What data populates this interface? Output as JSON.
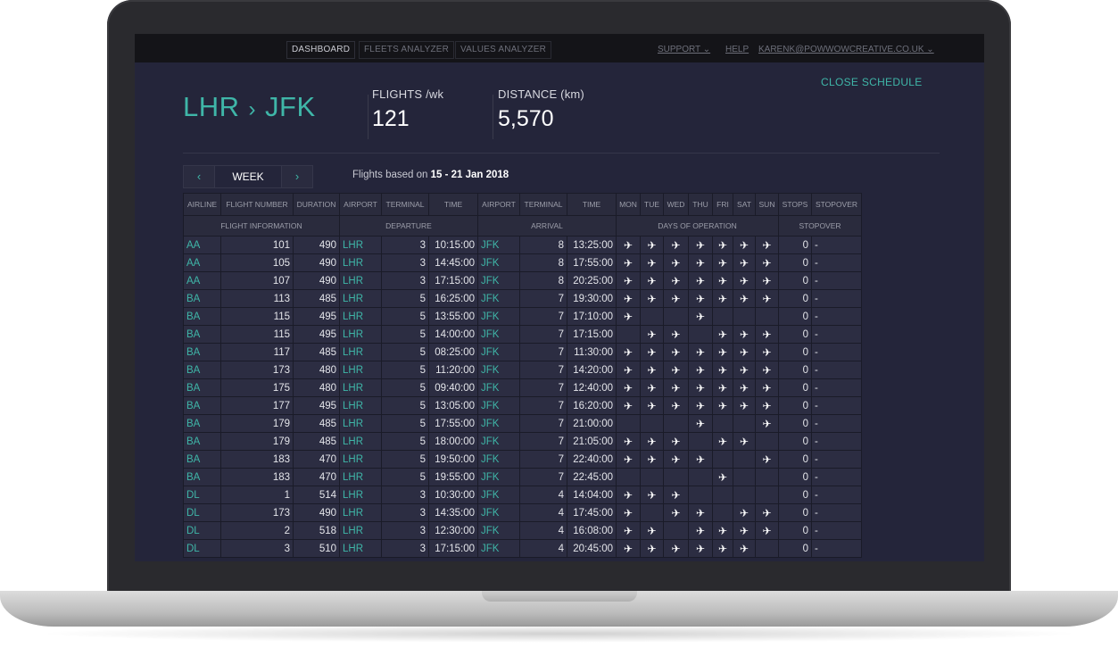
{
  "nav": {
    "tabs": [
      "DASHBOARD",
      "FLEETS ANALYZER",
      "VALUES ANALYZER"
    ],
    "support": "SUPPORT ⌄",
    "help": "HELP",
    "user": "KARENK@POWWOWCREATIVE.CO.UK ⌄"
  },
  "header": {
    "origin": "LHR",
    "arrow": "›",
    "destination": "JFK",
    "flights_label": "FLIGHTS /wk",
    "flights_value": "121",
    "distance_label": "DISTANCE (km)",
    "distance_value": "5,570",
    "close_label": "CLOSE SCHEDULE"
  },
  "period": {
    "prev": "‹",
    "label": "WEEK",
    "next": "›",
    "based_prefix": "Flights based on",
    "based_range": "15 - 21 Jan 2018"
  },
  "table": {
    "columns": [
      "AIRLINE",
      "FLIGHT NUMBER",
      "DURATION",
      "AIRPORT",
      "TERMINAL",
      "TIME",
      "AIRPORT",
      "TERMINAL",
      "TIME",
      "MON",
      "TUE",
      "WED",
      "THU",
      "FRI",
      "SAT",
      "SUN",
      "STOPS",
      "STOPOVER"
    ],
    "groups": [
      "FLIGHT INFORMATION",
      "DEPARTURE",
      "ARRIVAL",
      "DAYS OF OPERATION",
      "STOPOVER"
    ],
    "check_glyph": "✈",
    "rows": [
      {
        "airline": "AA",
        "flight": "101",
        "duration": "490",
        "dep_airport": "LHR",
        "dep_terminal": "3",
        "dep_time": "10:15:00",
        "arr_airport": "JFK",
        "arr_terminal": "8",
        "arr_time": "13:25:00",
        "days": [
          1,
          1,
          1,
          1,
          1,
          1,
          1
        ],
        "stops": "0",
        "stopover": "-"
      },
      {
        "airline": "AA",
        "flight": "105",
        "duration": "490",
        "dep_airport": "LHR",
        "dep_terminal": "3",
        "dep_time": "14:45:00",
        "arr_airport": "JFK",
        "arr_terminal": "8",
        "arr_time": "17:55:00",
        "days": [
          1,
          1,
          1,
          1,
          1,
          1,
          1
        ],
        "stops": "0",
        "stopover": "-"
      },
      {
        "airline": "AA",
        "flight": "107",
        "duration": "490",
        "dep_airport": "LHR",
        "dep_terminal": "3",
        "dep_time": "17:15:00",
        "arr_airport": "JFK",
        "arr_terminal": "8",
        "arr_time": "20:25:00",
        "days": [
          1,
          1,
          1,
          1,
          1,
          1,
          1
        ],
        "stops": "0",
        "stopover": "-"
      },
      {
        "airline": "BA",
        "flight": "113",
        "duration": "485",
        "dep_airport": "LHR",
        "dep_terminal": "5",
        "dep_time": "16:25:00",
        "arr_airport": "JFK",
        "arr_terminal": "7",
        "arr_time": "19:30:00",
        "days": [
          1,
          1,
          1,
          1,
          1,
          1,
          1
        ],
        "stops": "0",
        "stopover": "-"
      },
      {
        "airline": "BA",
        "flight": "115",
        "duration": "495",
        "dep_airport": "LHR",
        "dep_terminal": "5",
        "dep_time": "13:55:00",
        "arr_airport": "JFK",
        "arr_terminal": "7",
        "arr_time": "17:10:00",
        "days": [
          1,
          0,
          0,
          1,
          0,
          0,
          0
        ],
        "stops": "0",
        "stopover": "-"
      },
      {
        "airline": "BA",
        "flight": "115",
        "duration": "495",
        "dep_airport": "LHR",
        "dep_terminal": "5",
        "dep_time": "14:00:00",
        "arr_airport": "JFK",
        "arr_terminal": "7",
        "arr_time": "17:15:00",
        "days": [
          0,
          1,
          1,
          0,
          1,
          1,
          1
        ],
        "stops": "0",
        "stopover": "-"
      },
      {
        "airline": "BA",
        "flight": "117",
        "duration": "485",
        "dep_airport": "LHR",
        "dep_terminal": "5",
        "dep_time": "08:25:00",
        "arr_airport": "JFK",
        "arr_terminal": "7",
        "arr_time": "11:30:00",
        "days": [
          1,
          1,
          1,
          1,
          1,
          1,
          1
        ],
        "stops": "0",
        "stopover": "-"
      },
      {
        "airline": "BA",
        "flight": "173",
        "duration": "480",
        "dep_airport": "LHR",
        "dep_terminal": "5",
        "dep_time": "11:20:00",
        "arr_airport": "JFK",
        "arr_terminal": "7",
        "arr_time": "14:20:00",
        "days": [
          1,
          1,
          1,
          1,
          1,
          1,
          1
        ],
        "stops": "0",
        "stopover": "-"
      },
      {
        "airline": "BA",
        "flight": "175",
        "duration": "480",
        "dep_airport": "LHR",
        "dep_terminal": "5",
        "dep_time": "09:40:00",
        "arr_airport": "JFK",
        "arr_terminal": "7",
        "arr_time": "12:40:00",
        "days": [
          1,
          1,
          1,
          1,
          1,
          1,
          1
        ],
        "stops": "0",
        "stopover": "-"
      },
      {
        "airline": "BA",
        "flight": "177",
        "duration": "495",
        "dep_airport": "LHR",
        "dep_terminal": "5",
        "dep_time": "13:05:00",
        "arr_airport": "JFK",
        "arr_terminal": "7",
        "arr_time": "16:20:00",
        "days": [
          1,
          1,
          1,
          1,
          1,
          1,
          1
        ],
        "stops": "0",
        "stopover": "-"
      },
      {
        "airline": "BA",
        "flight": "179",
        "duration": "485",
        "dep_airport": "LHR",
        "dep_terminal": "5",
        "dep_time": "17:55:00",
        "arr_airport": "JFK",
        "arr_terminal": "7",
        "arr_time": "21:00:00",
        "days": [
          0,
          0,
          0,
          1,
          0,
          0,
          1
        ],
        "stops": "0",
        "stopover": "-"
      },
      {
        "airline": "BA",
        "flight": "179",
        "duration": "485",
        "dep_airport": "LHR",
        "dep_terminal": "5",
        "dep_time": "18:00:00",
        "arr_airport": "JFK",
        "arr_terminal": "7",
        "arr_time": "21:05:00",
        "days": [
          1,
          1,
          1,
          0,
          1,
          1,
          0
        ],
        "stops": "0",
        "stopover": "-"
      },
      {
        "airline": "BA",
        "flight": "183",
        "duration": "470",
        "dep_airport": "LHR",
        "dep_terminal": "5",
        "dep_time": "19:50:00",
        "arr_airport": "JFK",
        "arr_terminal": "7",
        "arr_time": "22:40:00",
        "days": [
          1,
          1,
          1,
          1,
          0,
          0,
          1
        ],
        "stops": "0",
        "stopover": "-"
      },
      {
        "airline": "BA",
        "flight": "183",
        "duration": "470",
        "dep_airport": "LHR",
        "dep_terminal": "5",
        "dep_time": "19:55:00",
        "arr_airport": "JFK",
        "arr_terminal": "7",
        "arr_time": "22:45:00",
        "days": [
          0,
          0,
          0,
          0,
          1,
          0,
          0
        ],
        "stops": "0",
        "stopover": "-"
      },
      {
        "airline": "DL",
        "flight": "1",
        "duration": "514",
        "dep_airport": "LHR",
        "dep_terminal": "3",
        "dep_time": "10:30:00",
        "arr_airport": "JFK",
        "arr_terminal": "4",
        "arr_time": "14:04:00",
        "days": [
          1,
          1,
          1,
          0,
          0,
          0,
          0
        ],
        "stops": "0",
        "stopover": "-"
      },
      {
        "airline": "DL",
        "flight": "173",
        "duration": "490",
        "dep_airport": "LHR",
        "dep_terminal": "3",
        "dep_time": "14:35:00",
        "arr_airport": "JFK",
        "arr_terminal": "4",
        "arr_time": "17:45:00",
        "days": [
          1,
          0,
          1,
          1,
          0,
          1,
          1
        ],
        "stops": "0",
        "stopover": "-"
      },
      {
        "airline": "DL",
        "flight": "2",
        "duration": "518",
        "dep_airport": "LHR",
        "dep_terminal": "3",
        "dep_time": "12:30:00",
        "arr_airport": "JFK",
        "arr_terminal": "4",
        "arr_time": "16:08:00",
        "days": [
          1,
          1,
          0,
          1,
          1,
          1,
          1
        ],
        "stops": "0",
        "stopover": "-"
      },
      {
        "airline": "DL",
        "flight": "3",
        "duration": "510",
        "dep_airport": "LHR",
        "dep_terminal": "3",
        "dep_time": "17:15:00",
        "arr_airport": "JFK",
        "arr_terminal": "4",
        "arr_time": "20:45:00",
        "days": [
          1,
          1,
          1,
          1,
          1,
          1,
          0
        ],
        "stops": "0",
        "stopover": "-"
      }
    ]
  }
}
